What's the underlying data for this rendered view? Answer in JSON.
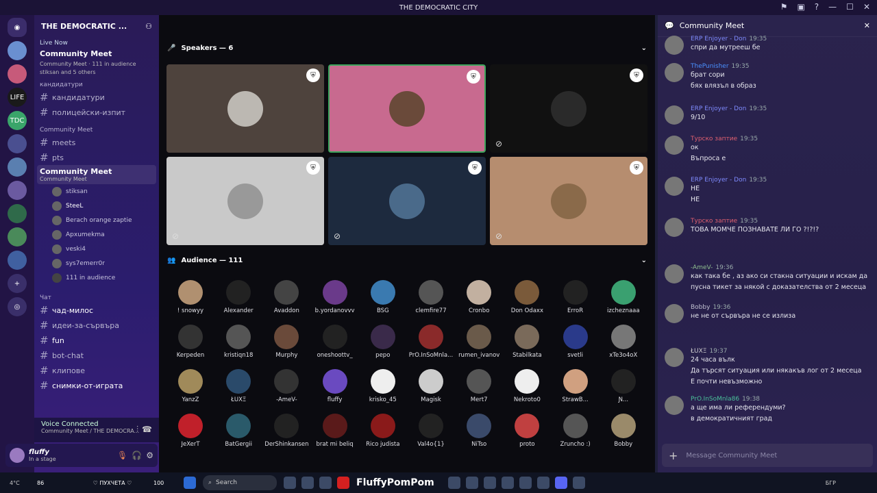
{
  "titlebar": {
    "title": "THE DEMOCRATIC CITY"
  },
  "guild": {
    "name": "THE DEMOCRATIC ..."
  },
  "live": {
    "badge": "Live Now",
    "title": "Community Meet",
    "sub": "Community Meet · 111 in audience",
    "others": "stiksan and 5 others"
  },
  "categories": [
    {
      "label": "кандидатури",
      "channels": [
        "кандидатури",
        "полицейски-изпит"
      ]
    },
    {
      "label": "Community Meet",
      "channels": [
        "meets",
        "pts"
      ]
    }
  ],
  "stage_channel": {
    "label": "Community Meet",
    "sub": "Community Meet"
  },
  "stage_users": [
    "stiksan",
    "SteeL",
    "Berach orange zaptie",
    "Архumekma",
    "veski4",
    "sys7emerr0r",
    "111 in audience"
  ],
  "chat_cat": {
    "label": "Чат"
  },
  "chat_channels": [
    "чад-милос",
    "идеи-за-сървъра",
    "fun",
    "bot-chat",
    "клипове",
    "снимки-от-играта"
  ],
  "voice": {
    "status": "Voice Connected",
    "where": "Community Meet / THE DEMOCRA..."
  },
  "me": {
    "name": "fluffy",
    "status": "In a stage"
  },
  "speakers": {
    "label": "Speakers — 6"
  },
  "audience": {
    "label": "Audience — 111",
    "names": [
      "! snowyy",
      "Alexander",
      "Avaddon",
      "b.yordanovvv",
      "BSG",
      "clemfire77",
      "Cronbo",
      "Don Odaxx",
      "ErroR",
      "izcheznaaa",
      "Kerpeden",
      "kristiqn18",
      "Murphy",
      "oneshoottv_",
      "pepo",
      "PrO.InSoMnla...",
      "rumen_ivanov",
      "Stabilkata",
      "svetli",
      "xTe3o4oX",
      "YanzZ",
      "ŁUXΞ",
      "-AmeV-",
      "fluffy",
      "krisko_45",
      "Magisk",
      "Mert7",
      "Nekroto0",
      "StrawB...",
      "Ɲ...",
      "JeXerT",
      "BatGergii",
      "DerShinkansen",
      "brat mi beliq",
      "Rico judista",
      "Val4o{1}",
      "NiTso",
      "proto",
      "Zruncho :)",
      "Bobby"
    ]
  },
  "chat": {
    "title": "Community Meet",
    "placeholder": "Message Community Meet",
    "messages": [
      {
        "name": "ERP Enjoyer - Don",
        "time": "19:35",
        "lines": [
          "спри да мутрееш бе"
        ]
      },
      {
        "name": "ThePunisher",
        "time": "19:35",
        "lines": [
          "брат сори",
          "бях влязъл в образ"
        ]
      },
      {
        "name": "ERP Enjoyer - Don",
        "time": "19:35",
        "lines": [
          "9/10"
        ]
      },
      {
        "name": "Турско заптие",
        "time": "19:35",
        "lines": [
          "ок",
          "Въпроса е"
        ]
      },
      {
        "name": "ERP Enjoyer - Don",
        "time": "19:35",
        "lines": [
          "НЕ",
          "НЕ"
        ]
      },
      {
        "name": "Турско заптие",
        "time": "19:35",
        "lines": [
          "ТОВА МОМЧЕ ПОЗНАВАТЕ ЛИ ГО ?!?!?"
        ]
      },
      {
        "name": "-AmeV-",
        "time": "19:36",
        "lines": [
          "как така бе , аз ако си стакна ситуации и искам да",
          "пусна тикет за някой с доказателства от 2 месеца"
        ]
      },
      {
        "name": "Bobby",
        "time": "19:36",
        "lines": [
          "не не от сървъра не се излиза"
        ]
      },
      {
        "name": "ŁUXΞ",
        "time": "19:37",
        "lines": [
          "24 часа вълк",
          "Да търсят ситуация или някакъв лог от 2 месеца",
          "Е почти невъзможно"
        ]
      },
      {
        "name": "PrO.InSoMnla86",
        "time": "19:38",
        "lines": [
          "а ще има ли референдуми?",
          "в демократичният град"
        ]
      }
    ]
  },
  "taskbar": {
    "search": "Search",
    "yt": "FluffyPomPom",
    "lang": "БГР",
    "temp": "4°C",
    "left_num": "86",
    "center": "♡ ПУХЧЕТА ♡",
    "right_num": "100"
  }
}
